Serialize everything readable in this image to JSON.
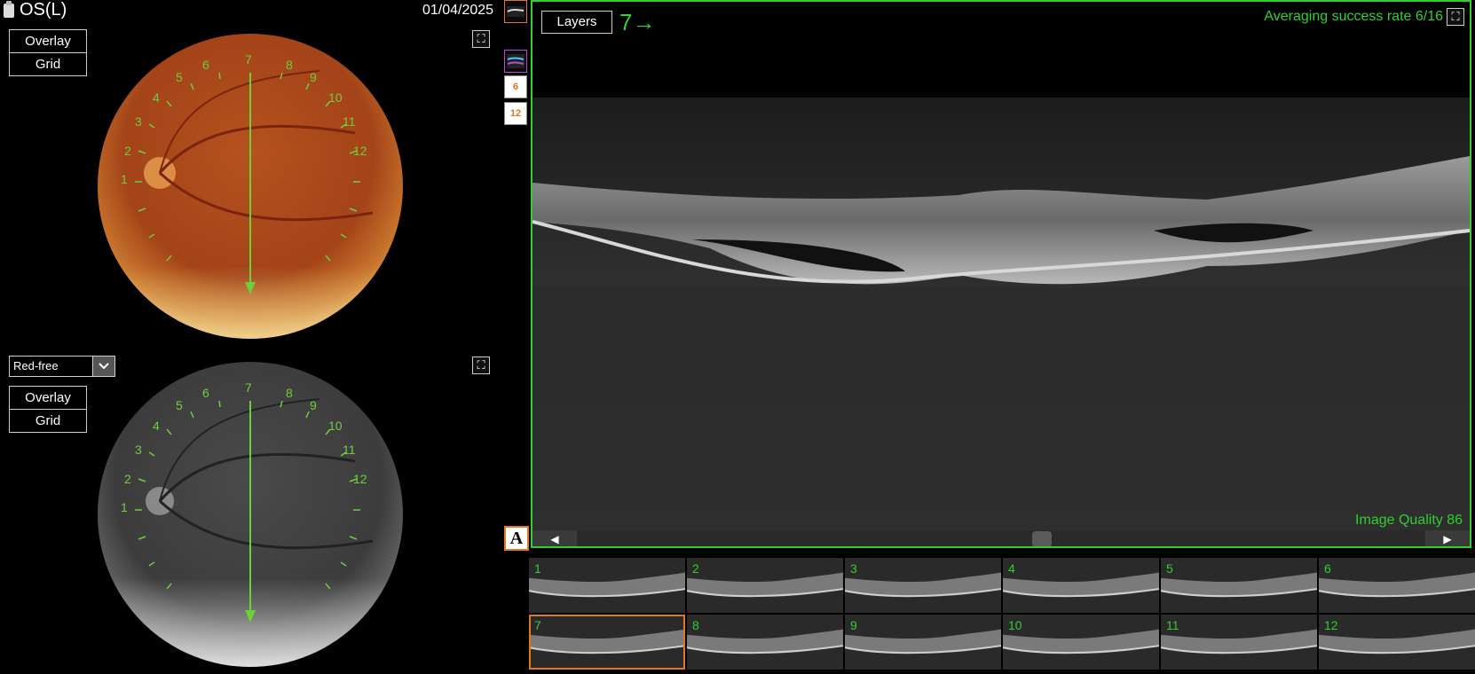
{
  "header": {
    "eye": "OS(L)",
    "date": "01/04/2025"
  },
  "top_fundus": {
    "overlay_label": "Overlay",
    "grid_label": "Grid",
    "clock_labels": [
      "1",
      "2",
      "3",
      "4",
      "5",
      "6",
      "7",
      "8",
      "9",
      "10",
      "11",
      "12"
    ]
  },
  "bottom_fundus": {
    "filter": "Red-free",
    "overlay_label": "Overlay",
    "grid_label": "Grid",
    "clock_labels": [
      "1",
      "2",
      "3",
      "4",
      "5",
      "6",
      "7",
      "8",
      "9",
      "10",
      "11",
      "12"
    ]
  },
  "tools": {
    "six": "6",
    "twelve": "12",
    "annotate": "A"
  },
  "bscan": {
    "layers_label": "Layers",
    "slice_indicator": "7→",
    "averaging": "Averaging success rate 6/16",
    "image_quality": "Image Quality 86"
  },
  "thumbnails": [
    {
      "label": "1"
    },
    {
      "label": "2"
    },
    {
      "label": "3"
    },
    {
      "label": "4"
    },
    {
      "label": "5"
    },
    {
      "label": "6"
    },
    {
      "label": "7"
    },
    {
      "label": "8"
    },
    {
      "label": "9"
    },
    {
      "label": "10"
    },
    {
      "label": "11"
    },
    {
      "label": "12"
    }
  ],
  "selected_thumbnail": "7",
  "colors": {
    "accent_green": "#2fd02f",
    "selection_orange": "#e0762a"
  }
}
